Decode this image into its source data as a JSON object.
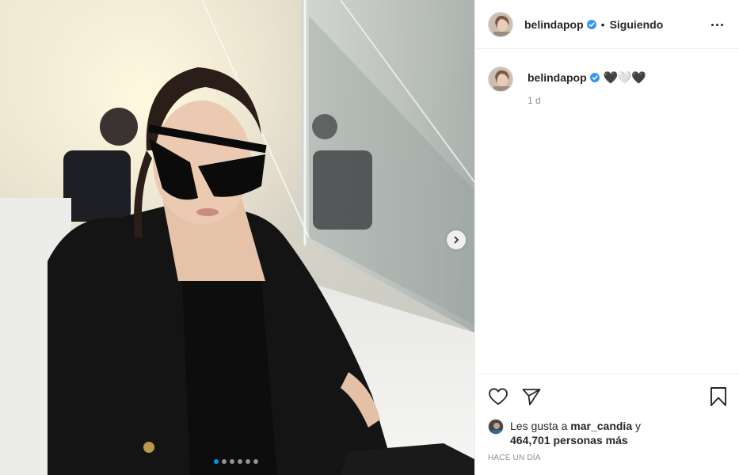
{
  "post": {
    "author": "belindapop",
    "follow_state": "Siguiendo",
    "separator": "•",
    "caption_emoji": "🖤🤍🖤",
    "caption_age": "1 d",
    "likes_prefix": "Les gusta a",
    "likes_first_user": "mar_candia",
    "likes_and": "y",
    "likes_count_text": "464,701 personas más",
    "posted_ago": "HACE UN DÍA"
  },
  "carousel": {
    "total_slides": 6,
    "active_slide": 1
  },
  "icons": {
    "verified": "verified-badge-icon",
    "more": "more-options-icon",
    "like": "heart-icon",
    "share": "send-icon",
    "save": "bookmark-icon",
    "next": "chevron-right-icon"
  },
  "colors": {
    "verified_blue": "#3897f0",
    "active_dot": "#0095f6",
    "text_primary": "#262626",
    "text_secondary": "#8e8e8e"
  }
}
